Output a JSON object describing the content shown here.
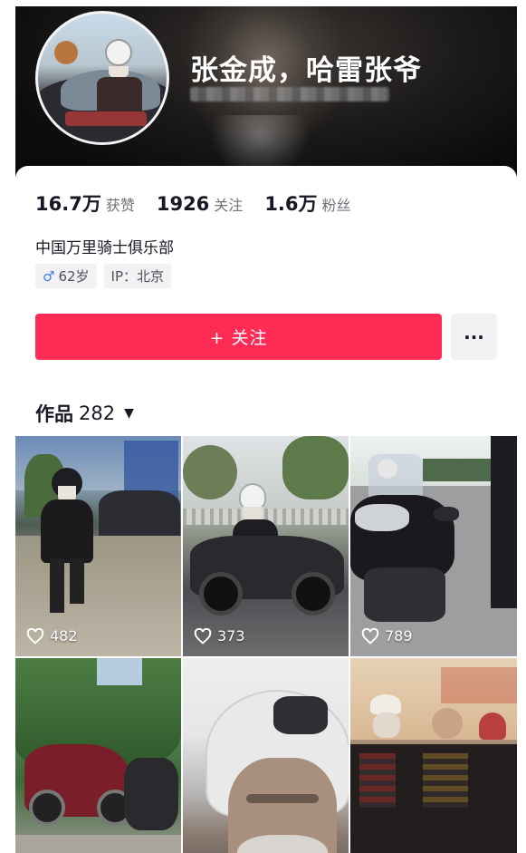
{
  "profile": {
    "nickname": "张金成，哈雷张爷",
    "stats": [
      {
        "value": "16.7万",
        "label": "获赞"
      },
      {
        "value": "1926",
        "label": "关注"
      },
      {
        "value": "1.6万",
        "label": "粉丝"
      }
    ],
    "bio": "中国万里骑士俱乐部",
    "tags": {
      "gender_icon": "♂",
      "age": "62岁",
      "ip": "IP：北京"
    }
  },
  "actions": {
    "follow_label": "+ 关注",
    "more_label": "···"
  },
  "works": {
    "title": "作品",
    "count": "282",
    "caret": "▼",
    "items": [
      {
        "likes": "482"
      },
      {
        "likes": "373"
      },
      {
        "likes": "789"
      },
      {
        "likes": ""
      },
      {
        "likes": ""
      },
      {
        "likes": ""
      }
    ]
  },
  "colors": {
    "accent": "#fe2c55",
    "text_primary": "#161823",
    "text_secondary": "#70727b"
  }
}
